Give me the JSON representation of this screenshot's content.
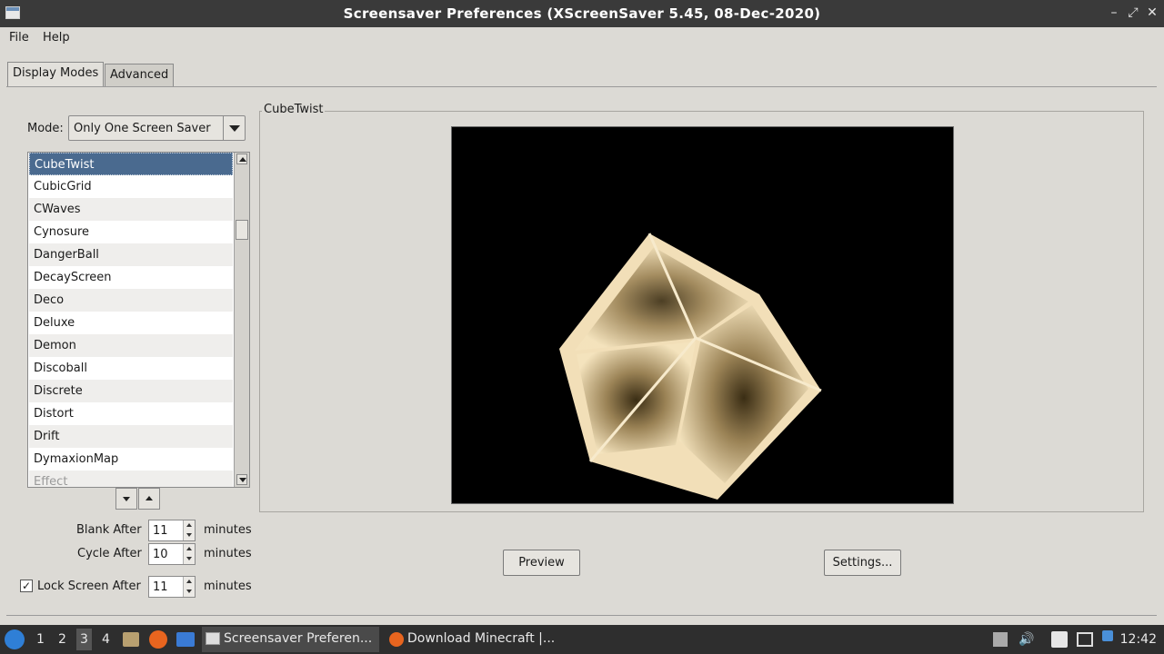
{
  "window": {
    "title": "Screensaver Preferences  (XScreenSaver 5.45, 08-Dec-2020)",
    "controls": [
      "–",
      "⤢",
      "✕"
    ]
  },
  "menu": {
    "file": "File",
    "help": "Help"
  },
  "tabs": {
    "display_modes": "Display Modes",
    "advanced": "Advanced"
  },
  "mode": {
    "label": "Mode:",
    "value": "Only One Screen Saver"
  },
  "list": {
    "items": [
      "CubeTwist",
      "CubicGrid",
      "CWaves",
      "Cynosure",
      "DangerBall",
      "DecayScreen",
      "Deco",
      "Deluxe",
      "Demon",
      "Discoball",
      "Discrete",
      "Distort",
      "Drift",
      "DymaxionMap",
      "Effect"
    ],
    "selected_index": 0
  },
  "timing": {
    "blank_label": "Blank After",
    "blank_value": "11",
    "cycle_label": "Cycle After",
    "cycle_value": "10",
    "lock_label": "Lock Screen After",
    "lock_value": "11",
    "lock_checked": true,
    "unit": "minutes"
  },
  "preview": {
    "title": "CubeTwist",
    "preview_button": "Preview",
    "settings_button": "Settings..."
  },
  "taskbar": {
    "workspaces": [
      "1",
      "2",
      "3",
      "4"
    ],
    "current_workspace": "3",
    "tasks": [
      "Screensaver Preferen...",
      "Download Minecraft |..."
    ],
    "clock": "12:42"
  },
  "colors": {
    "selection": "#4a6a8f",
    "cube": "#f2dfb8",
    "titlebar": "#3a3a3a"
  }
}
